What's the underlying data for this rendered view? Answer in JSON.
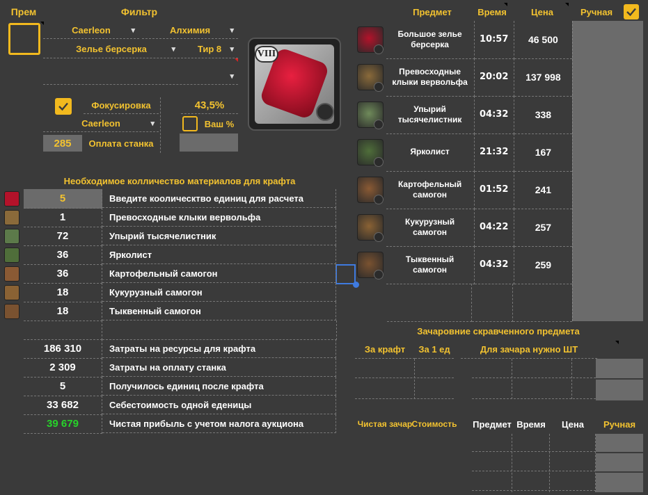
{
  "top": {
    "prem_label": "Прем",
    "filter_label": "Фильтр",
    "city_select": "Caerleon",
    "category_select": "Алхимия",
    "item_select": "Зелье берсерка",
    "tier_select": "Тир 8",
    "focus_label": "Фокусировка",
    "focus_percent": "43,5%",
    "city_select2": "Caerleon",
    "your_percent_label": "Ваш %",
    "station_fee_value": "285",
    "station_fee_label": "Оплата станка",
    "item_tier_badge": "VIII"
  },
  "materials": {
    "title": "Необходимое колличество материалов для крафта",
    "rows": [
      {
        "qty": "5",
        "label": "Введите коолическтво единиц для расчета",
        "icon": "berserker-potion-icon",
        "color": "#b3122a"
      },
      {
        "qty": "1",
        "label": "Превосходные клыки вервольфа",
        "icon": "werewolf-fangs-icon",
        "color": "#8a6a3a"
      },
      {
        "qty": "72",
        "label": "Упырий тысячелистник",
        "icon": "yarrow-icon",
        "color": "#5c7a4a"
      },
      {
        "qty": "36",
        "label": "Ярколист",
        "icon": "brightleaf-icon",
        "color": "#4f6e3a"
      },
      {
        "qty": "36",
        "label": "Картофельный самогон",
        "icon": "potato-schnapps-icon",
        "color": "#8a5a34"
      },
      {
        "qty": "18",
        "label": "Кукурузный самогон",
        "icon": "corn-hooch-icon",
        "color": "#8a6234"
      },
      {
        "qty": "18",
        "label": "Тыквенный самогон",
        "icon": "pumpkin-moonshine-icon",
        "color": "#7a5230"
      }
    ],
    "summary": [
      {
        "value": "186 310",
        "label": "Затраты на ресурсы для крафта"
      },
      {
        "value": "2 309",
        "label": "Затраты на оплату станка"
      },
      {
        "value": "5",
        "label": "Получилось единиц после крафта"
      },
      {
        "value": "33 682",
        "label": "Себестоимость одной еденицы"
      },
      {
        "value": "39 679",
        "label": "Чистая прибыль с учетом налога аукциона"
      }
    ]
  },
  "prices": {
    "headers": {
      "item": "Предмет",
      "time": "Время",
      "price": "Цена",
      "manual": "Ручная"
    },
    "rows": [
      {
        "name": "Большое зелье берсерка",
        "time": "10:57",
        "price": "46 500",
        "color": "#b3122a"
      },
      {
        "name": "Превосходные клыки вервольфа",
        "time": "20:02",
        "price": "137 998",
        "color": "#8a6a3a"
      },
      {
        "name": "Упырий тысячелистник",
        "time": "04:32",
        "price": "338",
        "color": "#6f8a5a"
      },
      {
        "name": "Ярколист",
        "time": "21:32",
        "price": "167",
        "color": "#4f6e3a"
      },
      {
        "name": "Картофельный самогон",
        "time": "01:52",
        "price": "241",
        "color": "#8a5a34"
      },
      {
        "name": "Кукурузный самогон",
        "time": "04:22",
        "price": "257",
        "color": "#8a6234"
      },
      {
        "name": "Тыквенный самогон",
        "time": "04:32",
        "price": "259",
        "color": "#7a5230"
      }
    ]
  },
  "enchant": {
    "title": "Зачаровние скравченного предмета",
    "per_craft": "За крафт",
    "per_unit": "За 1 ед",
    "needed": "Для зачара нужно ШТ",
    "net_enchant": "Чистая зачар",
    "cost": "Стоимость",
    "item": "Предмет",
    "time": "Время",
    "price": "Цена",
    "manual": "Ручная"
  },
  "colors": {
    "accent": "#f2c230",
    "profit": "#27d32a",
    "background": "#3a3a3a"
  }
}
